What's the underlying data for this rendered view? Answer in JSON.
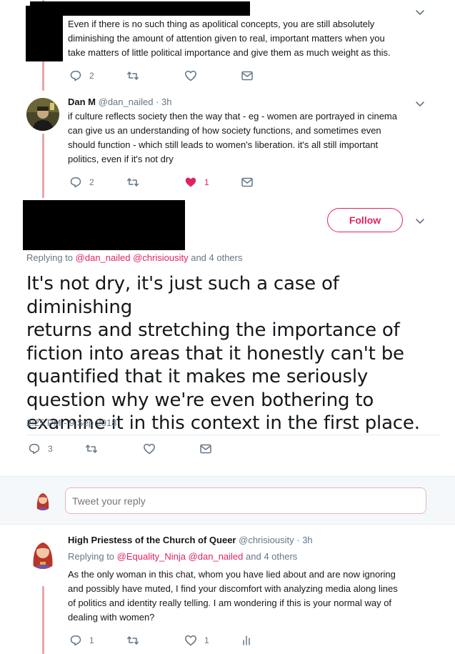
{
  "tweet1": {
    "text_lines": [
      "Even if there is no such thing as apolitical concepts, you are still absolutely",
      "diminishing the amount of attention given to real, important matters when you",
      "take matters of little political importance and give them as much weight as this."
    ],
    "reply_count": "2",
    "retweet_count": "",
    "like_count": ""
  },
  "tweet2": {
    "name": "Dan M",
    "handle": "@dan_nailed",
    "time": "· 3h",
    "text_lines": [
      "if culture reflects society then the way that - eg - women are portrayed in cinema",
      "can give us an understanding of how society functions, and sometimes even",
      "should function - which still leads to women's liberation. it's all still important",
      "politics, even if it's not dry"
    ],
    "reply_count": "2",
    "retweet_count": "",
    "like_count": "1"
  },
  "main_tweet": {
    "follow_label": "Follow",
    "replying_prefix": "Replying to",
    "replying_mentions": "@dan_nailed @chrisiousity",
    "replying_suffix": "and 4 others",
    "text_lines": [
      "It's not dry, it's just such a case of diminishing",
      "returns and stretching the importance of",
      "fiction into areas that it honestly can't be",
      "quantified that it makes me seriously",
      "question why we're even bothering to",
      "examine it in this context in the first place."
    ],
    "timestamp": "2:25 PM - 9 Sep 2018",
    "reply_count": "3"
  },
  "reply_box": {
    "placeholder": "Tweet your reply"
  },
  "tweet4": {
    "name": "High Priestess of the Church of Queer",
    "handle": "@chrisiousity",
    "time": "· 3h",
    "replying_prefix": "Replying to",
    "replying_mentions": "@Equality_Ninja @dan_nailed",
    "replying_suffix": "and 4 others",
    "text_lines": [
      "As the only woman in this chat, whom you have lied about and are now ignoring",
      "and possibly have muted, I find your discomfort with analyzing media along lines",
      "of politics and identity really telling. I am wondering if this is your normal way of",
      "dealing with women?"
    ],
    "reply_count": "1",
    "like_count": "1"
  },
  "colors": {
    "accent": "#e0245e",
    "thread_line": "#e8a7a7",
    "secondary_text": "#657786"
  }
}
